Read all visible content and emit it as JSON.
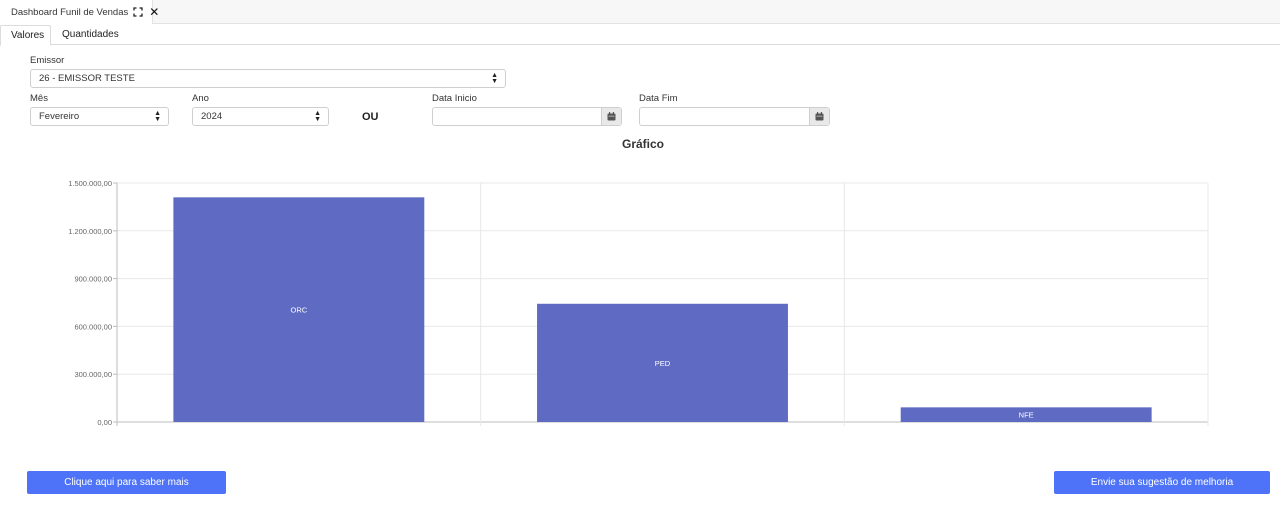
{
  "window_tab": {
    "title": "Dashboard Funil de Vendas"
  },
  "subtabs": [
    {
      "label": "Valores"
    },
    {
      "label": "Quantidades"
    }
  ],
  "filters": {
    "emissor_label": "Emissor",
    "emissor_value": "26 - EMISSOR TESTE",
    "mes_label": "Mês",
    "mes_value": "Fevereiro",
    "ano_label": "Ano",
    "ano_value": "2024",
    "or_label": "OU",
    "data_inicio_label": "Data Inicio",
    "data_inicio_value": "",
    "data_fim_label": "Data Fim",
    "data_fim_value": ""
  },
  "chart_title": "Gráfico",
  "chart_data": {
    "type": "bar",
    "categories": [
      "ORC",
      "PED",
      "NFE"
    ],
    "values": [
      1410000,
      742000,
      92000
    ],
    "ylim": [
      0,
      1500000
    ],
    "yticks": [
      "0,00",
      "300.000,00",
      "600.000,00",
      "900.000,00",
      "1.200.000,00",
      "1.500.000,00"
    ],
    "ytick_values": [
      0,
      300000,
      600000,
      900000,
      1200000,
      1500000
    ],
    "bar_color": "#5f6bc2",
    "grid": true,
    "data_labels_inside": true
  },
  "buttons": {
    "saber_mais": "Clique aqui para saber mais",
    "sugestao": "Envie sua sugestão de melhoria"
  },
  "colors": {
    "accent": "#4e73f8",
    "bar": "#5f6bc2"
  }
}
